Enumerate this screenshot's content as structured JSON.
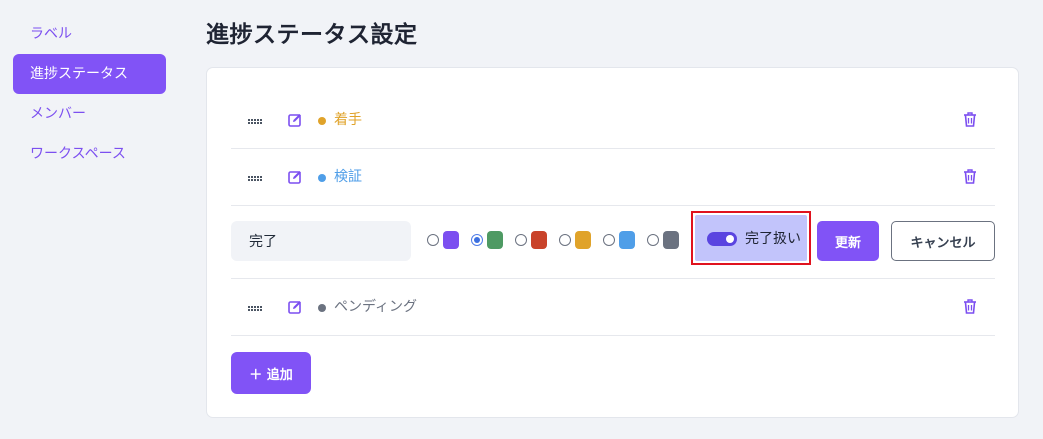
{
  "sidebar": {
    "items": [
      {
        "label": "ラベル",
        "active": false
      },
      {
        "label": "進捗ステータス",
        "active": true
      },
      {
        "label": "メンバー",
        "active": false
      },
      {
        "label": "ワークスペース",
        "active": false
      }
    ]
  },
  "page": {
    "title": "進捗ステータス設定"
  },
  "statuses": [
    {
      "label": "着手",
      "color": "#e0a32a"
    },
    {
      "label": "検証",
      "color": "#4f9ee8"
    },
    {
      "label": "ペンディング",
      "color": "#6b7280"
    }
  ],
  "editor": {
    "name_value": "完了",
    "colors": [
      "#7c4ff0",
      "#4e9a63",
      "#c9432a",
      "#e0a32a",
      "#4f9ee8",
      "#6b7280"
    ],
    "selected_color_index": 1,
    "done_toggle_label": "完了扱い",
    "done_toggle_on": true,
    "update_label": "更新",
    "cancel_label": "キャンセル"
  },
  "add_label": "＋ 追加",
  "theme": {
    "accent": "#8153f6",
    "highlight_border": "#e0121e",
    "toggle_bg": "#c2c4fb"
  }
}
